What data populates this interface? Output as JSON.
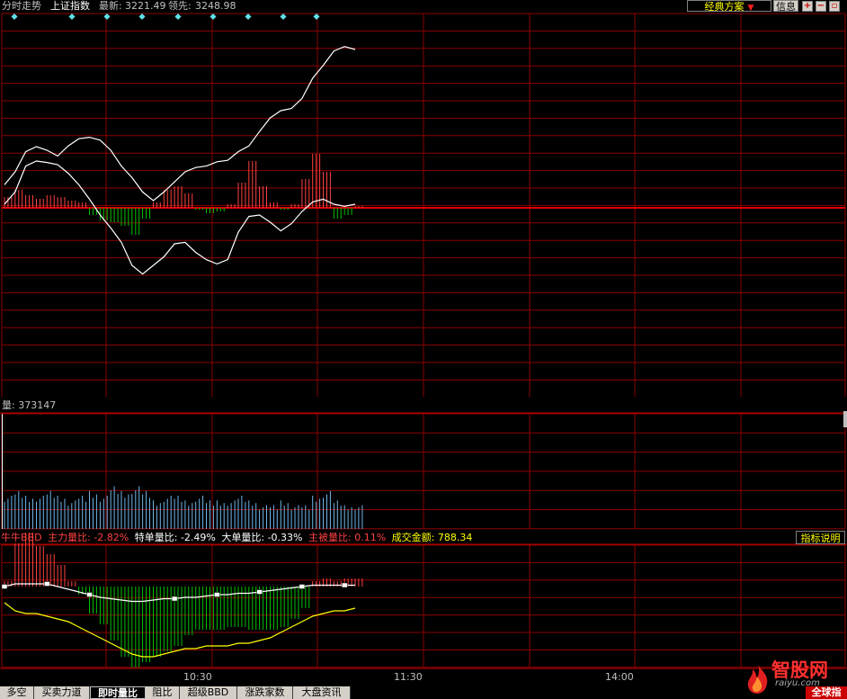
{
  "header": {
    "view_title": "分时走势",
    "index_name": "上证指数",
    "latest_label": "最新:",
    "latest_value": "3221.49",
    "lead_label": "领先:",
    "lead_value": "3248.98",
    "scheme_label": "经典方案",
    "info_label": "信息"
  },
  "colors": {
    "grid": "#8b0000",
    "zero_axis": "#e00000",
    "up_bar": "#ff4040",
    "down_bar": "#00c000",
    "price_line": "#ffffff",
    "volume_bar": "#6fb6e8",
    "bbd_yellow": "#ffff00",
    "diamond": "#5fe0e8"
  },
  "volume_pane": {
    "label": "量:",
    "value": "373147"
  },
  "bbd_pane": {
    "name": "牛牛BBD",
    "main_label": "主力量比:",
    "main_value": "-2.82%",
    "special_label": "特单量比:",
    "special_value": "-2.49%",
    "big_label": "大单量比:",
    "big_value": "-0.33%",
    "active_label": "主被量比:",
    "active_value": "0.11%",
    "amount_label": "成交金额:",
    "amount_value": "788.34",
    "help_label": "指标说明"
  },
  "time_axis": [
    "10:30",
    "11:30",
    "14:00"
  ],
  "tabs": [
    {
      "label": "多空",
      "active": false
    },
    {
      "label": "买卖力道",
      "active": false
    },
    {
      "label": "即时量比",
      "active": true
    },
    {
      "label": "阻比",
      "active": false
    },
    {
      "label": "超级BBD",
      "active": false
    },
    {
      "label": "涨跌家数",
      "active": false
    },
    {
      "label": "大盘资讯",
      "active": false
    }
  ],
  "logo": {
    "name": "智股网",
    "url": "raiyu.com",
    "corner_tag": "全球指"
  },
  "chart_data": {
    "type": "line",
    "x_session": "09:30–15:00 intraday, data through about 11:05",
    "series": [
      {
        "values": [
          0.32,
          0.5,
          0.78,
          0.85,
          0.8,
          0.72,
          0.86,
          0.96,
          0.98,
          0.94,
          0.8,
          0.58,
          0.42,
          0.22,
          0.1,
          0.22,
          0.36,
          0.5,
          0.56,
          0.58,
          0.64,
          0.66,
          0.78,
          0.86,
          1.06,
          1.25,
          1.35,
          1.38,
          1.52,
          1.8,
          1.98,
          2.18,
          2.24,
          2.2
        ]
      },
      {
        "values": [
          0.05,
          0.22,
          0.58,
          0.65,
          0.63,
          0.6,
          0.48,
          0.32,
          0.12,
          -0.1,
          -0.28,
          -0.48,
          -0.8,
          -0.92,
          -0.8,
          -0.68,
          -0.5,
          -0.48,
          -0.62,
          -0.72,
          -0.78,
          -0.72,
          -0.34,
          -0.12,
          -0.1,
          -0.2,
          -0.32,
          -0.22,
          -0.05,
          0.08,
          0.12,
          0.05,
          0.02,
          0.05
        ]
      },
      {
        "values": [
          0.6,
          1.0,
          0.7,
          0.5,
          0.7,
          0.6,
          0.4,
          0.3,
          -0.4,
          -0.7,
          -0.8,
          -1.0,
          -1.5,
          -0.6,
          0.3,
          1.0,
          1.2,
          0.8,
          -0.1,
          -0.3,
          -0.2,
          0.2,
          1.4,
          2.6,
          1.2,
          0.3,
          -0.1,
          0.2,
          1.6,
          3.0,
          2.0,
          -0.6,
          -0.4,
          0.1
        ]
      },
      {
        "values": [
          7,
          8,
          7,
          7,
          8,
          7,
          6,
          7,
          8,
          7,
          9,
          8,
          9,
          8,
          6,
          7,
          7,
          6,
          7,
          6,
          6,
          6,
          7,
          6,
          5,
          5,
          6,
          5,
          5,
          7,
          8,
          6,
          5,
          5
        ]
      },
      {
        "values": [
          0.0,
          0.1,
          0.1,
          0.1,
          0.1,
          0.0,
          -0.1,
          -0.2,
          -0.3,
          -0.4,
          -0.45,
          -0.5,
          -0.55,
          -0.55,
          -0.5,
          -0.45,
          -0.45,
          -0.4,
          -0.4,
          -0.35,
          -0.3,
          -0.3,
          -0.25,
          -0.25,
          -0.2,
          -0.15,
          -0.1,
          -0.05,
          0.0,
          0.05,
          0.05,
          0.05,
          0.05,
          0.05
        ]
      },
      {
        "values": [
          0.2,
          1.6,
          2.0,
          1.5,
          1.2,
          0.8,
          0.2,
          -0.3,
          -1.0,
          -1.4,
          -2.0,
          -2.6,
          -3.0,
          -2.8,
          -2.6,
          -2.4,
          -2.2,
          -1.8,
          -1.6,
          -1.6,
          -1.6,
          -1.5,
          -1.5,
          -1.6,
          -1.6,
          -1.6,
          -1.5,
          -1.2,
          -0.8,
          0.2,
          0.3,
          0.2,
          0.3,
          0.3
        ]
      },
      {
        "values": [
          -0.6,
          -0.9,
          -1.0,
          -1.0,
          -1.1,
          -1.2,
          -1.3,
          -1.5,
          -1.7,
          -1.9,
          -2.1,
          -2.3,
          -2.5,
          -2.6,
          -2.6,
          -2.5,
          -2.4,
          -2.3,
          -2.3,
          -2.2,
          -2.2,
          -2.2,
          -2.1,
          -2.1,
          -2.0,
          -1.9,
          -1.7,
          -1.5,
          -1.3,
          -1.1,
          -1.0,
          -0.9,
          -0.9,
          -0.8
        ]
      }
    ]
  }
}
